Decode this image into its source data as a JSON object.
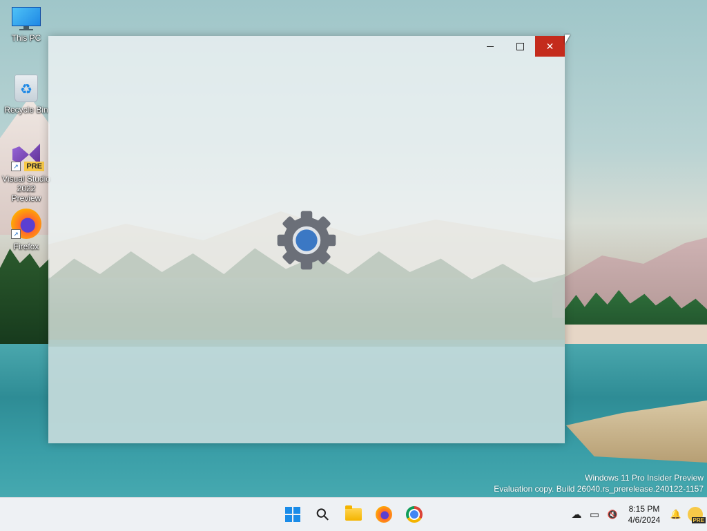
{
  "desktop": {
    "icons": [
      {
        "label": "This PC",
        "icon": "computer-icon"
      },
      {
        "label": "Recycle Bin",
        "icon": "recycle-bin-icon"
      },
      {
        "label": "Visual Studio 2022 Preview",
        "icon": "visual-studio-icon",
        "badge": "PRE"
      },
      {
        "label": "Firefox",
        "icon": "firefox-icon"
      }
    ],
    "shortcut_glyph": "↗",
    "recycle_glyph": "♻"
  },
  "window": {
    "minimize_icon": "minimize-icon",
    "maximize_icon": "maximize-icon",
    "close_label": "✕",
    "splash_icon": "gear-icon",
    "gear_color": "#6b6f78",
    "accent_color": "#3b78c4",
    "close_color": "#c42b1c"
  },
  "watermark": {
    "line1": "Windows 11 Pro Insider Preview",
    "line2": "Evaluation copy. Build 26040.rs_prerelease.240122-1157"
  },
  "taskbar": {
    "apps": [
      "start-icon",
      "search-icon",
      "file-explorer-icon",
      "firefox-icon",
      "chrome-icon"
    ],
    "search_glyph": "⚲",
    "tray": {
      "cloud_glyph": "☁",
      "network_glyph": "▭",
      "volume_glyph": "🔇",
      "notification_glyph": "🔔",
      "time": "8:15 PM",
      "date": "4/6/2024",
      "pre_label": "PRE"
    }
  }
}
